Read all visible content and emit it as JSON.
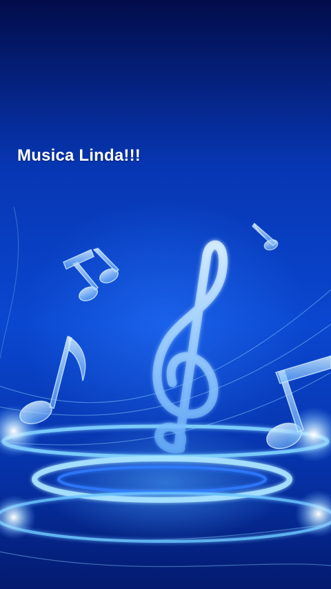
{
  "caption": {
    "text": "Musica Linda!!!"
  },
  "scene": {
    "subject": "treble-clef-and-music-notes",
    "colors": {
      "background_top": "#020c4a",
      "background_mid": "#0a47d0",
      "glow": "#7fd0ff",
      "note": "#a9d8ff"
    }
  }
}
